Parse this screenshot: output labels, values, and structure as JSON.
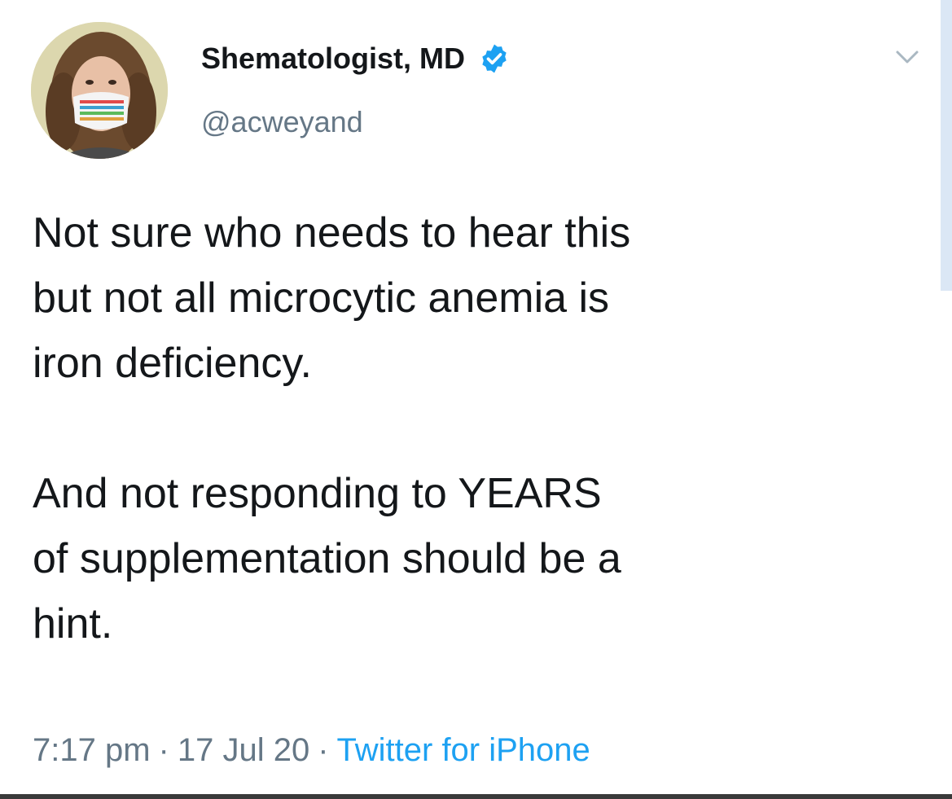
{
  "tweet": {
    "author": {
      "display_name": "Shematologist, MD",
      "handle": "@acweyand",
      "verified": true
    },
    "body": "Not sure who needs to hear this\nbut not all microcytic anemia is\niron deficiency.\n\nAnd not responding to YEARS\nof supplementation should be a\nhint.",
    "time": "7:17 pm",
    "date": "17 Jul 20",
    "source": "Twitter for iPhone",
    "separator": "·"
  },
  "colors": {
    "text": "#14171a",
    "secondary": "#657786",
    "link": "#1da1f2",
    "verified": "#1da1f2"
  },
  "icons": {
    "verified": "verified-badge-icon",
    "menu": "chevron-down-icon"
  }
}
